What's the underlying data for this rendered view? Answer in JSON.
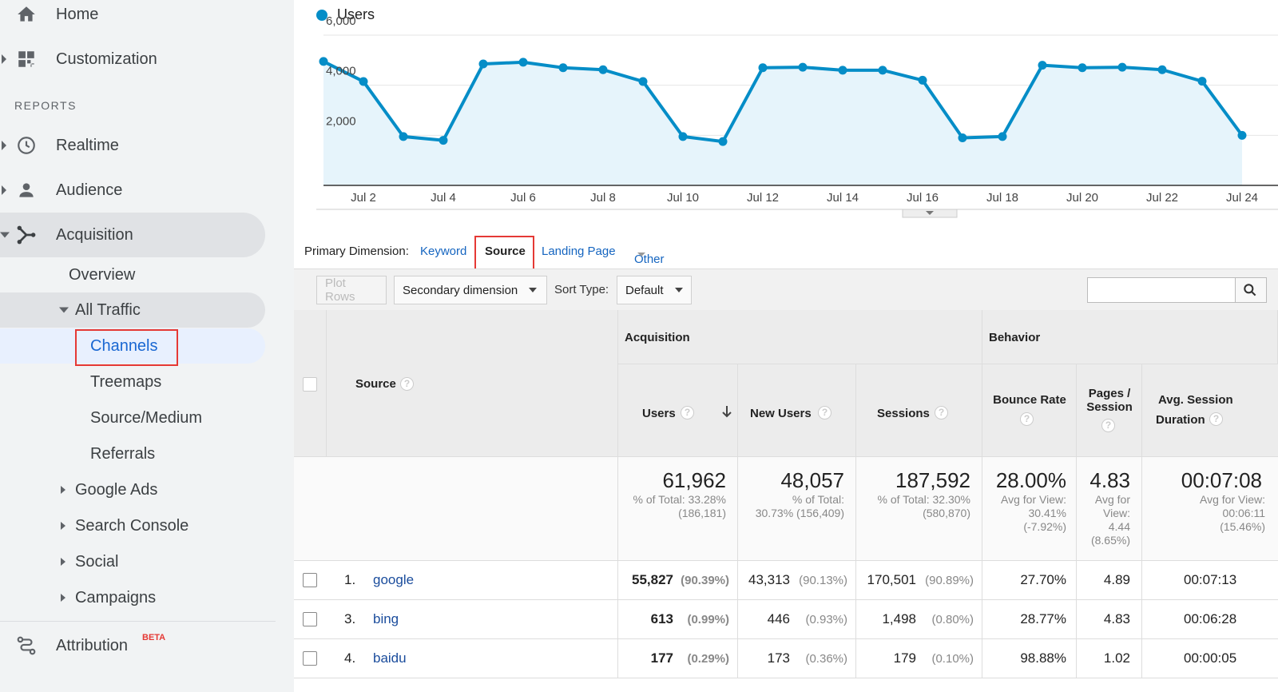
{
  "sidebar": {
    "home": "Home",
    "customization": "Customization",
    "reports_heading": "REPORTS",
    "realtime": "Realtime",
    "audience": "Audience",
    "acquisition": "Acquisition",
    "overview": "Overview",
    "all_traffic": "All Traffic",
    "channels": "Channels",
    "treemaps": "Treemaps",
    "source_medium": "Source/Medium",
    "referrals": "Referrals",
    "google_ads": "Google Ads",
    "search_console": "Search Console",
    "social": "Social",
    "campaigns": "Campaigns",
    "attribution": "Attribution",
    "attribution_badge": "BETA"
  },
  "chart_data": {
    "type": "area",
    "legend": "Users",
    "series_color": "#058dc7",
    "y_ticks": [
      "6,000",
      "4,000",
      "2,000"
    ],
    "ylim": [
      0,
      6000
    ],
    "x_labels": [
      "Jul 2",
      "Jul 4",
      "Jul 6",
      "Jul 8",
      "Jul 10",
      "Jul 12",
      "Jul 14",
      "Jul 16",
      "Jul 18",
      "Jul 20",
      "Jul 22",
      "Jul 24"
    ],
    "x_label_start_day": 2,
    "x_label_step_days": 2,
    "x": [
      "Jul 1",
      "Jul 2",
      "Jul 3",
      "Jul 4",
      "Jul 5",
      "Jul 6",
      "Jul 7",
      "Jul 8",
      "Jul 9",
      "Jul 10",
      "Jul 11",
      "Jul 12",
      "Jul 13",
      "Jul 14",
      "Jul 15",
      "Jul 16",
      "Jul 17",
      "Jul 18",
      "Jul 19",
      "Jul 20",
      "Jul 21",
      "Jul 22",
      "Jul 23",
      "Jul 24"
    ],
    "values": [
      4950,
      4150,
      1950,
      1800,
      4850,
      4920,
      4700,
      4620,
      4150,
      1950,
      1750,
      4700,
      4720,
      4600,
      4600,
      4200,
      1900,
      1950,
      4800,
      4700,
      4720,
      4620,
      4160,
      2000
    ],
    "grid": true
  },
  "primary_dimension": {
    "label": "Primary Dimension:",
    "keyword": "Keyword",
    "source": "Source",
    "landing_page": "Landing Page",
    "other": "Other"
  },
  "toolbar": {
    "plot_rows": "Plot Rows",
    "secondary_dimension": "Secondary dimension",
    "sort_type_label": "Sort Type:",
    "sort_type_value": "Default"
  },
  "table": {
    "headers": {
      "source": "Source",
      "acquisition": "Acquisition",
      "behavior": "Behavior",
      "users": "Users",
      "new_users": "New Users",
      "sessions": "Sessions",
      "bounce_rate": "Bounce Rate",
      "pages_session_1": "Pages /",
      "pages_session_2": "Session",
      "avg_session_1": "Avg. Session",
      "avg_session_2": "Duration"
    },
    "totals": {
      "users": "61,962",
      "users_sub1": "% of Total: 33.28%",
      "users_sub2": "(186,181)",
      "new_users": "48,057",
      "new_users_sub1": "% of Total:",
      "new_users_sub2": "30.73% (156,409)",
      "sessions": "187,592",
      "sessions_sub1": "% of Total: 32.30%",
      "sessions_sub2": "(580,870)",
      "bounce_rate": "28.00%",
      "bounce_sub1": "Avg for View:",
      "bounce_sub2": "30.41%",
      "bounce_sub3": "(-7.92%)",
      "pages": "4.83",
      "pages_sub1": "Avg for",
      "pages_sub2": "View:",
      "pages_sub3": "4.44",
      "pages_sub4": "(8.65%)",
      "avg": "00:07:08",
      "avg_sub1": "Avg for View:",
      "avg_sub2": "00:06:11",
      "avg_sub3": "(15.46%)"
    },
    "rows": [
      {
        "rank": "1.",
        "source": "google",
        "users": "55,827",
        "users_pct": "(90.39%)",
        "new_users": "43,313",
        "new_users_pct": "(90.13%)",
        "sessions": "170,501",
        "sessions_pct": "(90.89%)",
        "bounce": "27.70%",
        "pages": "4.89",
        "avg": "00:07:13"
      },
      {
        "rank": "3.",
        "source": "bing",
        "users": "613",
        "users_pct": "(0.99%)",
        "new_users": "446",
        "new_users_pct": "(0.93%)",
        "sessions": "1,498",
        "sessions_pct": "(0.80%)",
        "bounce": "28.77%",
        "pages": "4.83",
        "avg": "00:06:28"
      },
      {
        "rank": "4.",
        "source": "baidu",
        "users": "177",
        "users_pct": "(0.29%)",
        "new_users": "173",
        "new_users_pct": "(0.36%)",
        "sessions": "179",
        "sessions_pct": "(0.10%)",
        "bounce": "98.88%",
        "pages": "1.02",
        "avg": "00:00:05"
      }
    ]
  }
}
